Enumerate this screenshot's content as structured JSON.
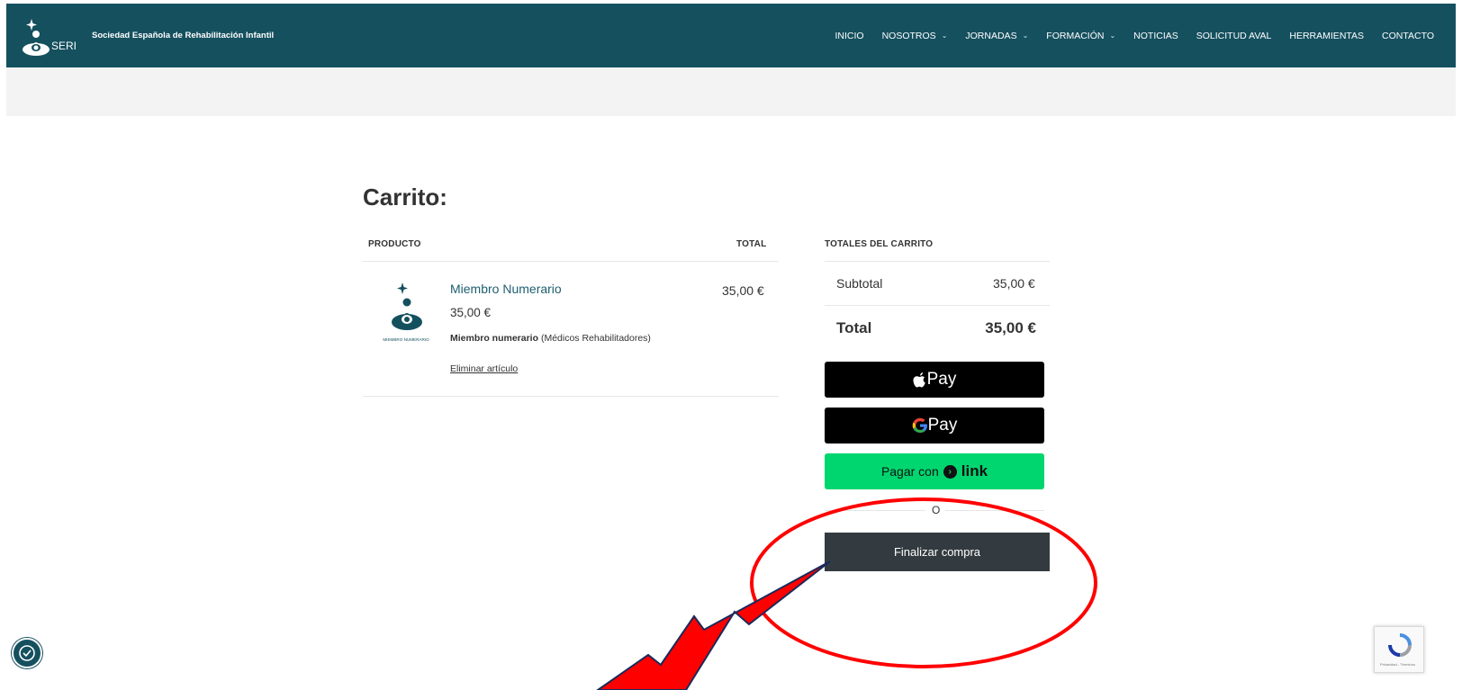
{
  "colors": {
    "header_bg": "#15505f",
    "accent_link": "#1d5e6f",
    "checkout_bg": "#333b40",
    "link_green": "#00d66f",
    "annotation_red": "#ff0000"
  },
  "header": {
    "logo_text": "SERI",
    "site_name": "Sociedad Española de Rehabilitación Infantil",
    "nav": [
      {
        "label": "INICIO",
        "dropdown": false
      },
      {
        "label": "NOSOTROS",
        "dropdown": true
      },
      {
        "label": "JORNADAS",
        "dropdown": true
      },
      {
        "label": "FORMACIÓN",
        "dropdown": true
      },
      {
        "label": "NOTICIAS",
        "dropdown": false
      },
      {
        "label": "SOLICITUD AVAL",
        "dropdown": false
      },
      {
        "label": "HERRAMIENTAS",
        "dropdown": false
      },
      {
        "label": "CONTACTO",
        "dropdown": false
      }
    ],
    "chevron": "⌄"
  },
  "cart": {
    "title": "Carrito:",
    "columns": {
      "product": "PRODUCTO",
      "total": "TOTAL"
    },
    "item": {
      "image_caption": "MIEMBRO NUMERARIO",
      "name": "Miembro Numerario",
      "price": "35,00 €",
      "meta_label": "Miembro numerario",
      "meta_value": "(Médicos Rehabilitadores)",
      "remove": "Eliminar artículo",
      "line_total": "35,00 €"
    }
  },
  "totals": {
    "heading": "TOTALES DEL CARRITO",
    "subtotal_label": "Subtotal",
    "subtotal_value": "35,00 €",
    "total_label": "Total",
    "total_value": "35,00 €"
  },
  "payment": {
    "apple_pay": "Pay",
    "google_pay": "Pay",
    "link_prefix": "Pagar con",
    "link_word": "link",
    "or": "O",
    "checkout": "Finalizar compra"
  },
  "widgets": {
    "recaptcha_text": "Privacidad - Términos"
  },
  "icons": {
    "logo": "seri-logo-icon",
    "apple": "apple-icon",
    "google": "google-g-icon",
    "link": "link-arrow-icon",
    "accessibility": "accessibility-icon",
    "recaptcha": "recaptcha-icon"
  }
}
